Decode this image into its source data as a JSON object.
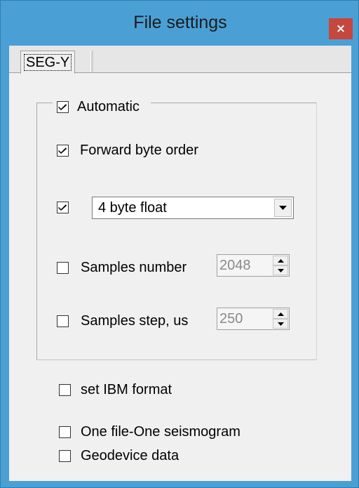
{
  "window": {
    "title": "File settings",
    "close_label": "×"
  },
  "tabs": [
    {
      "label": "SEG-Y",
      "selected": true
    }
  ],
  "group": {
    "automatic": {
      "label": "Automatic",
      "checked": true
    },
    "forward_byte_order": {
      "label": "Forward byte order",
      "checked": true
    },
    "format": {
      "checked": true,
      "selected": "4 byte float"
    },
    "samples_number": {
      "label": "Samples number",
      "checked": false,
      "value": "2048"
    },
    "samples_step": {
      "label": "Samples step, us",
      "checked": false,
      "value": "250"
    }
  },
  "options": {
    "set_ibm_format": {
      "label": "set IBM format",
      "checked": false
    },
    "one_file_one_seismogram": {
      "label": "One file-One seismogram",
      "checked": false
    },
    "geodevice_data": {
      "label": "Geodevice data",
      "checked": false
    }
  },
  "colors": {
    "frame": "#4aa0d5",
    "close_button": "#c7473c",
    "client": "#f0f0f0"
  }
}
